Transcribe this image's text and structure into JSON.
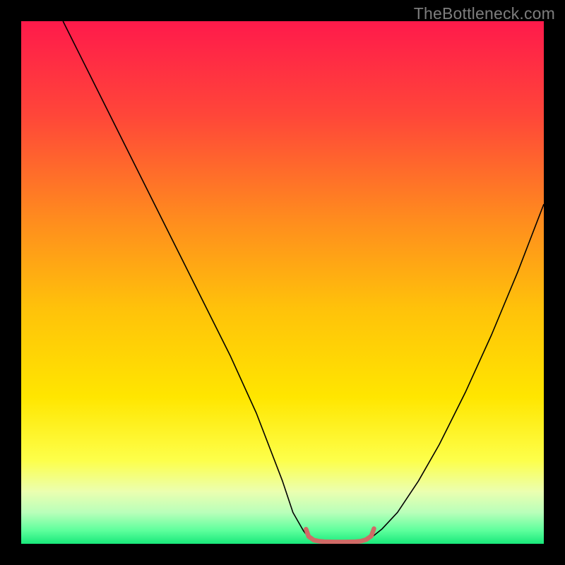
{
  "watermark": "TheBottleneck.com",
  "chart_data": {
    "type": "line",
    "title": "",
    "xlabel": "",
    "ylabel": "",
    "xlim": [
      0,
      100
    ],
    "ylim": [
      0,
      100
    ],
    "grid": false,
    "legend": false,
    "background_gradient_stops": [
      {
        "offset": 0.0,
        "color": "#ff1a4b"
      },
      {
        "offset": 0.18,
        "color": "#ff4639"
      },
      {
        "offset": 0.38,
        "color": "#ff8c1e"
      },
      {
        "offset": 0.55,
        "color": "#ffc20a"
      },
      {
        "offset": 0.72,
        "color": "#ffe600"
      },
      {
        "offset": 0.84,
        "color": "#fdff4a"
      },
      {
        "offset": 0.9,
        "color": "#ebffb0"
      },
      {
        "offset": 0.94,
        "color": "#b9ffba"
      },
      {
        "offset": 0.975,
        "color": "#5cff9c"
      },
      {
        "offset": 1.0,
        "color": "#18e87a"
      }
    ],
    "series": [
      {
        "name": "left-curve",
        "stroke": "#000000",
        "stroke_width": 1.6,
        "x": [
          8,
          12,
          16,
          20,
          25,
          30,
          35,
          40,
          45,
          50,
          52,
          54,
          55
        ],
        "y": [
          100,
          92,
          84,
          76,
          66,
          56,
          46,
          36,
          25,
          12,
          6,
          2.5,
          1.2
        ]
      },
      {
        "name": "right-curve",
        "stroke": "#000000",
        "stroke_width": 1.6,
        "x": [
          67,
          69,
          72,
          76,
          80,
          85,
          90,
          95,
          100
        ],
        "y": [
          1.2,
          2.8,
          6,
          12,
          19,
          29,
          40,
          52,
          65
        ]
      },
      {
        "name": "trough-band",
        "stroke": "#d06a66",
        "stroke_width": 6.5,
        "linecap": "round",
        "x": [
          54.5,
          55,
          56,
          57,
          58,
          60,
          62,
          64,
          65,
          66,
          67,
          67.5
        ],
        "y": [
          2.8,
          1.4,
          0.7,
          0.5,
          0.4,
          0.35,
          0.35,
          0.4,
          0.5,
          0.8,
          1.5,
          2.9
        ]
      }
    ]
  }
}
